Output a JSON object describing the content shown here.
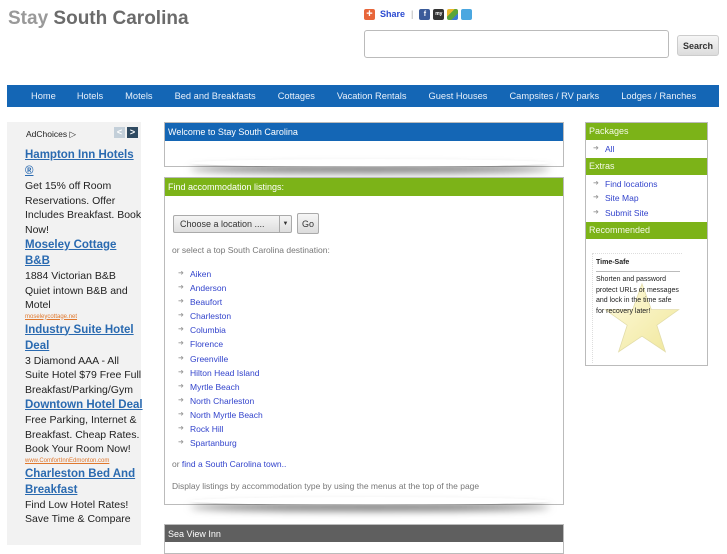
{
  "header": {
    "title_light": "Stay",
    "title_bold": "South Carolina",
    "share": {
      "label": "Share",
      "separator": "|",
      "icons": [
        "facebook-icon",
        "myspace-icon",
        "google-icon",
        "twitter-icon"
      ],
      "myspace_text": "my",
      "facebook_text": "f"
    },
    "search": {
      "value": "",
      "placeholder": "",
      "button_label": "Search"
    }
  },
  "nav": {
    "items": [
      "Home",
      "Hotels",
      "Motels",
      "Bed and Breakfasts",
      "Cottages",
      "Vacation Rentals",
      "Guest Houses",
      "Campsites / RV parks",
      "Lodges / Ranches"
    ]
  },
  "ads": {
    "adchoices_label": "AdChoices ▷",
    "prev_glyph": "<",
    "next_glyph": ">",
    "items": [
      {
        "title": "Hampton Inn Hotels ®",
        "body": "Get 15% off Room Reservations. Offer Includes Breakfast. Book Now!",
        "url": ""
      },
      {
        "title": "Moseley Cottage B&B",
        "body": "1884 Victorian B&B Quiet intown B&B and Motel",
        "url": "moseleycottage.net"
      },
      {
        "title": "Industry Suite Hotel Deal",
        "body": "3 Diamond AAA - All Suite Hotel $79 Free Full Breakfast/Parking/Gym",
        "url": ""
      },
      {
        "title": "Downtown Hotel Deal",
        "body": "Free Parking, Internet & Breakfast. Cheap Rates. Book Your Room Now!",
        "url": "www.ComfortInnEdmonton.com"
      },
      {
        "title": "Charleston Bed And Breakfast",
        "body": "Find Low Hotel Rates! Save Time & Compare",
        "url": ""
      }
    ]
  },
  "main": {
    "welcome_title": "Welcome to Stay South Carolina",
    "find": {
      "title": "Find accommodation listings:",
      "select_value": "Choose a location ....",
      "go_label": "Go",
      "select_text": "or select a top South Carolina destination:",
      "destinations": [
        "Aiken",
        "Anderson",
        "Beaufort",
        "Charleston",
        "Columbia",
        "Florence",
        "Greenville",
        "Hilton Head Island",
        "Myrtle Beach",
        "North Charleston",
        "North Myrtle Beach",
        "Rock Hill",
        "Spartanburg"
      ],
      "town_prefix": "or ",
      "town_link": "find a South Carolina town..",
      "display_text": "Display listings by accommodation type by using the menus at the top of the page"
    },
    "sea_view_title": "Sea View Inn"
  },
  "right": {
    "packages_title": "Packages",
    "packages": [
      "All"
    ],
    "extras_title": "Extras",
    "extras": [
      "Find locations",
      "Site Map",
      "Submit Site"
    ],
    "recommended_title": "Recommended",
    "timesafe": {
      "title": "Time-Safe",
      "text": "Shorten and password protect URLs or messages and lock in the time safe for recovery later!"
    }
  },
  "colors": {
    "nav_blue": "#1466b5",
    "green": "#7cb318",
    "dark_gray": "#5f5f5f",
    "link_blue": "#3344cc",
    "ad_title": "#2a6ab0",
    "ad_url": "#e0782d"
  }
}
